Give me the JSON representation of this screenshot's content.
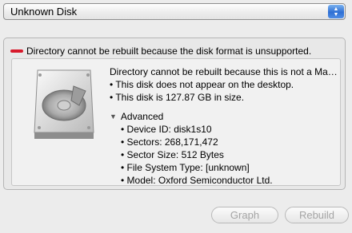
{
  "disk_select": {
    "value": "Unknown Disk"
  },
  "status": {
    "message": "Directory cannot be rebuilt because the disk format is unsupported."
  },
  "details": {
    "headline": "Directory cannot be rebuilt because this is not a Ma…",
    "bullets": [
      "• This disk does not appear on the desktop.",
      "• This disk is 127.87 GB in size."
    ],
    "advanced_label": "Advanced",
    "advanced_items": [
      "• Device ID: disk1s10",
      "• Sectors: 268,171,472",
      "• Sector Size: 512 Bytes",
      "• File System Type: [unknown]",
      "• Model: Oxford Semiconductor Ltd."
    ]
  },
  "buttons": {
    "graph": "Graph",
    "rebuild": "Rebuild"
  },
  "colors": {
    "status_red": "#d7192b",
    "select_blue": "#2f6fd3"
  },
  "icons": {
    "disk": "hard-disk-icon",
    "status": "red-status-bar-icon",
    "disclosure": "disclosure-triangle-down-icon",
    "popup": "updown-arrows-icon"
  }
}
